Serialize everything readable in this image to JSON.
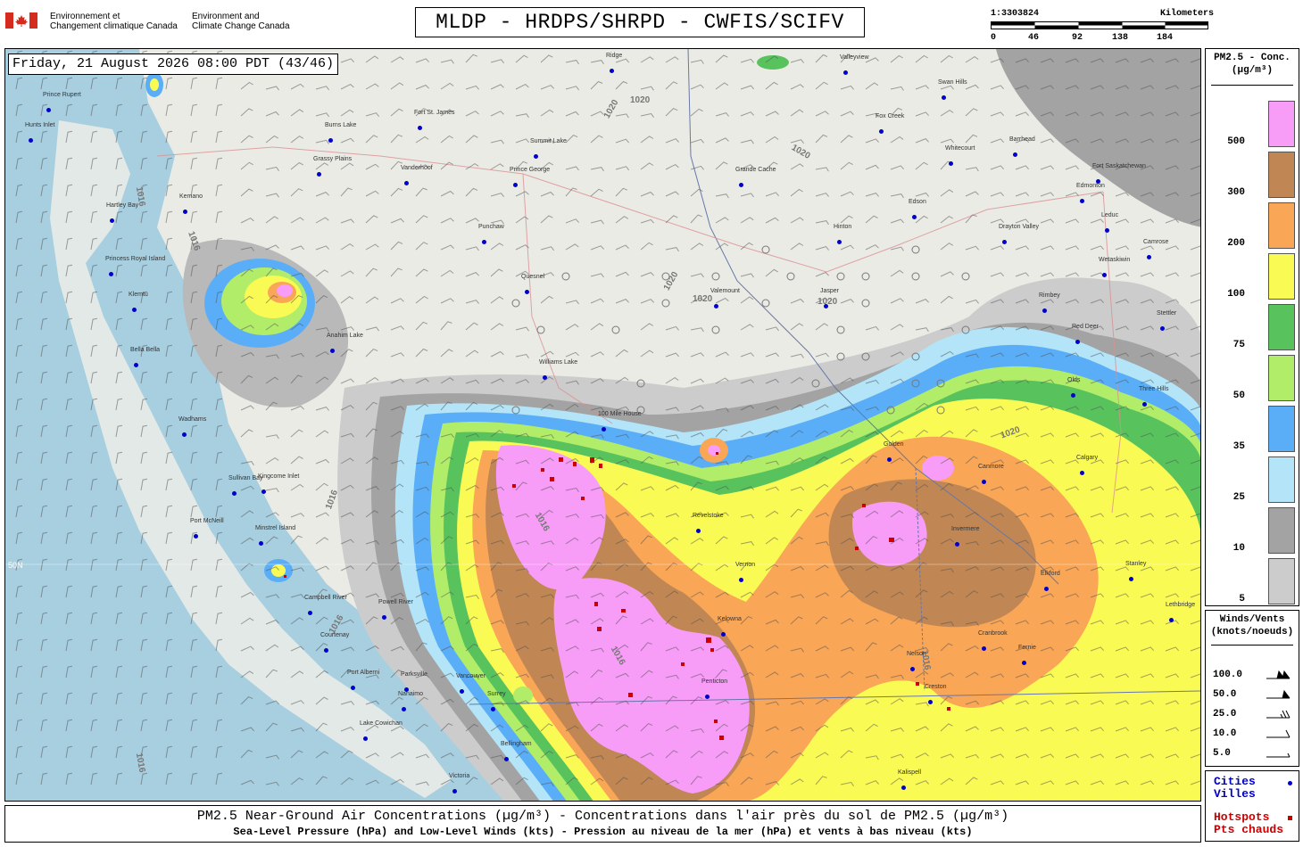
{
  "header": {
    "agency_fr": [
      "Environnement et",
      "Changement climatique Canada"
    ],
    "agency_en": [
      "Environment and",
      "Climate Change Canada"
    ],
    "title": "MLDP - HRDPS/SHRPD - CWFIS/SCIFV",
    "scale": {
      "ratio": "1:3303824",
      "unit": "Kilometers",
      "ticks": [
        "0",
        "46",
        "92",
        "138",
        "184"
      ]
    }
  },
  "map": {
    "timestamp": "Friday, 21 August 2026 08:00 PDT (43/46)",
    "latitude_label": "50N",
    "isobars": [
      "1016",
      "1016",
      "1016",
      "1016",
      "1016",
      "1016",
      "1016",
      "1016",
      "1020",
      "1020",
      "1020",
      "1020",
      "1020",
      "1020",
      "1020"
    ],
    "cities": [
      {
        "name": "Prince Rupert"
      },
      {
        "name": "Hunts Inlet"
      },
      {
        "name": "Burns Lake"
      },
      {
        "name": "Fort St. James"
      },
      {
        "name": "Summit Lake"
      },
      {
        "name": "Grassy Plains"
      },
      {
        "name": "Vanderhoof"
      },
      {
        "name": "Prince George"
      },
      {
        "name": "Grande Cache"
      },
      {
        "name": "Kemano"
      },
      {
        "name": "Hartley Bay"
      },
      {
        "name": "Punchaw"
      },
      {
        "name": "Princess Royal Island"
      },
      {
        "name": "Klemtu"
      },
      {
        "name": "Quesnel"
      },
      {
        "name": "Valemount"
      },
      {
        "name": "Jasper"
      },
      {
        "name": "Hinton"
      },
      {
        "name": "Edson"
      },
      {
        "name": "Bella Bella"
      },
      {
        "name": "Anahim Lake"
      },
      {
        "name": "Williams Lake"
      },
      {
        "name": "100 Mile House"
      },
      {
        "name": "Wadhams"
      },
      {
        "name": "Sullivan Bay"
      },
      {
        "name": "Kingcome Inlet"
      },
      {
        "name": "Port McNeill"
      },
      {
        "name": "Minstrel Island"
      },
      {
        "name": "Campbell River"
      },
      {
        "name": "Powell River"
      },
      {
        "name": "Courtenay"
      },
      {
        "name": "Port Alberni"
      },
      {
        "name": "Parksville"
      },
      {
        "name": "Nanaimo"
      },
      {
        "name": "Vancouver"
      },
      {
        "name": "Surrey"
      },
      {
        "name": "Lake Cowichan"
      },
      {
        "name": "Victoria"
      },
      {
        "name": "Bellingham"
      },
      {
        "name": "Kelowna"
      },
      {
        "name": "Penticton"
      },
      {
        "name": "Vernon"
      },
      {
        "name": "Revelstoke"
      },
      {
        "name": "Golden"
      },
      {
        "name": "Canmore"
      },
      {
        "name": "Calgary"
      },
      {
        "name": "Invermere"
      },
      {
        "name": "Cranbrook"
      },
      {
        "name": "Fernie"
      },
      {
        "name": "Nelson"
      },
      {
        "name": "Creston"
      },
      {
        "name": "Elkford"
      },
      {
        "name": "Red Deer"
      },
      {
        "name": "Rimbey"
      },
      {
        "name": "Edmonton"
      },
      {
        "name": "Leduc"
      },
      {
        "name": "Camrose"
      },
      {
        "name": "Wetaskiwin"
      },
      {
        "name": "Drayton Valley"
      },
      {
        "name": "Whitecourt"
      },
      {
        "name": "Fox Creek"
      },
      {
        "name": "Swan Hills"
      },
      {
        "name": "Barrhead"
      },
      {
        "name": "Fort Saskatchewan"
      },
      {
        "name": "Olds"
      },
      {
        "name": "Three Hills"
      },
      {
        "name": "Stettler"
      },
      {
        "name": "Valleyview"
      },
      {
        "name": "Ridge"
      },
      {
        "name": "Kalispell"
      },
      {
        "name": "Stanley"
      },
      {
        "name": "Lethbridge"
      }
    ]
  },
  "legend_concentration": {
    "title": [
      "PM2.5 - Conc.",
      "(µg/m³)"
    ],
    "bins": [
      {
        "label": "500",
        "color": "#f79cf7"
      },
      {
        "label": "300",
        "color": "#c08653"
      },
      {
        "label": "200",
        "color": "#f9a657"
      },
      {
        "label": "100",
        "color": "#fafa55"
      },
      {
        "label": "75",
        "color": "#58c35d"
      },
      {
        "label": "50",
        "color": "#b2ed6a"
      },
      {
        "label": "35",
        "color": "#5aaef7"
      },
      {
        "label": "25",
        "color": "#b3e4f8"
      },
      {
        "label": "10",
        "color": "#a3a3a3"
      },
      {
        "label": "5",
        "color": "#cccccc"
      }
    ]
  },
  "legend_winds": {
    "title": [
      "Winds/Vents",
      "(knots/noeuds)"
    ],
    "values": [
      "100.0",
      "50.0",
      "25.0",
      "10.0",
      "5.0"
    ]
  },
  "legend_marks": {
    "cities": [
      "Cities",
      "Villes"
    ],
    "hotspots": [
      "Hotspots",
      "Pts chauds"
    ],
    "city_color": "#0000cc",
    "hotspot_color": "#cc0000"
  },
  "footer": {
    "line1": "PM2.5 Near-Ground Air Concentrations (µg/m³) - Concentrations dans l'air près du sol de PM2.5 (µg/m³)",
    "line2": "Sea-Level Pressure (hPa) and Low-Level Winds (kts) - Pression au niveau de la mer (hPa) et vents à bas niveau (kts)"
  }
}
